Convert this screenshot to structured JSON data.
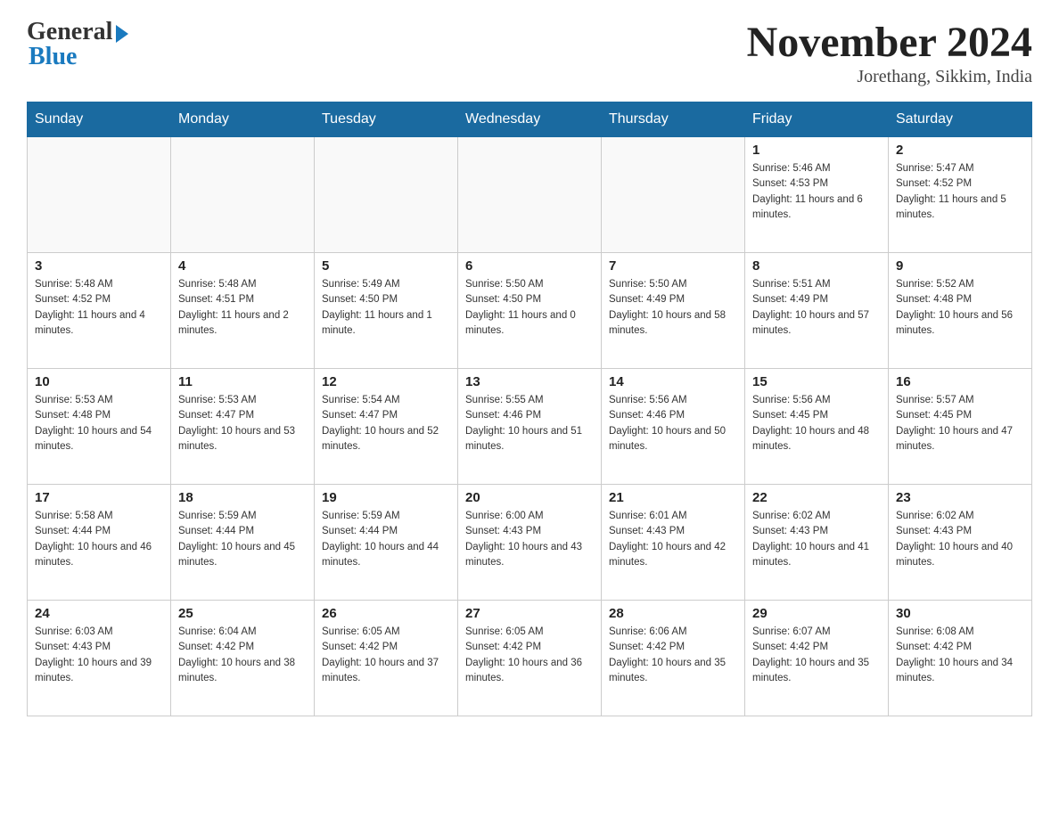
{
  "header": {
    "logo_general": "General",
    "logo_blue": "Blue",
    "month_title": "November 2024",
    "subtitle": "Jorethang, Sikkim, India"
  },
  "weekdays": [
    "Sunday",
    "Monday",
    "Tuesday",
    "Wednesday",
    "Thursday",
    "Friday",
    "Saturday"
  ],
  "weeks": [
    [
      {
        "day": "",
        "info": ""
      },
      {
        "day": "",
        "info": ""
      },
      {
        "day": "",
        "info": ""
      },
      {
        "day": "",
        "info": ""
      },
      {
        "day": "",
        "info": ""
      },
      {
        "day": "1",
        "info": "Sunrise: 5:46 AM\nSunset: 4:53 PM\nDaylight: 11 hours and 6 minutes."
      },
      {
        "day": "2",
        "info": "Sunrise: 5:47 AM\nSunset: 4:52 PM\nDaylight: 11 hours and 5 minutes."
      }
    ],
    [
      {
        "day": "3",
        "info": "Sunrise: 5:48 AM\nSunset: 4:52 PM\nDaylight: 11 hours and 4 minutes."
      },
      {
        "day": "4",
        "info": "Sunrise: 5:48 AM\nSunset: 4:51 PM\nDaylight: 11 hours and 2 minutes."
      },
      {
        "day": "5",
        "info": "Sunrise: 5:49 AM\nSunset: 4:50 PM\nDaylight: 11 hours and 1 minute."
      },
      {
        "day": "6",
        "info": "Sunrise: 5:50 AM\nSunset: 4:50 PM\nDaylight: 11 hours and 0 minutes."
      },
      {
        "day": "7",
        "info": "Sunrise: 5:50 AM\nSunset: 4:49 PM\nDaylight: 10 hours and 58 minutes."
      },
      {
        "day": "8",
        "info": "Sunrise: 5:51 AM\nSunset: 4:49 PM\nDaylight: 10 hours and 57 minutes."
      },
      {
        "day": "9",
        "info": "Sunrise: 5:52 AM\nSunset: 4:48 PM\nDaylight: 10 hours and 56 minutes."
      }
    ],
    [
      {
        "day": "10",
        "info": "Sunrise: 5:53 AM\nSunset: 4:48 PM\nDaylight: 10 hours and 54 minutes."
      },
      {
        "day": "11",
        "info": "Sunrise: 5:53 AM\nSunset: 4:47 PM\nDaylight: 10 hours and 53 minutes."
      },
      {
        "day": "12",
        "info": "Sunrise: 5:54 AM\nSunset: 4:47 PM\nDaylight: 10 hours and 52 minutes."
      },
      {
        "day": "13",
        "info": "Sunrise: 5:55 AM\nSunset: 4:46 PM\nDaylight: 10 hours and 51 minutes."
      },
      {
        "day": "14",
        "info": "Sunrise: 5:56 AM\nSunset: 4:46 PM\nDaylight: 10 hours and 50 minutes."
      },
      {
        "day": "15",
        "info": "Sunrise: 5:56 AM\nSunset: 4:45 PM\nDaylight: 10 hours and 48 minutes."
      },
      {
        "day": "16",
        "info": "Sunrise: 5:57 AM\nSunset: 4:45 PM\nDaylight: 10 hours and 47 minutes."
      }
    ],
    [
      {
        "day": "17",
        "info": "Sunrise: 5:58 AM\nSunset: 4:44 PM\nDaylight: 10 hours and 46 minutes."
      },
      {
        "day": "18",
        "info": "Sunrise: 5:59 AM\nSunset: 4:44 PM\nDaylight: 10 hours and 45 minutes."
      },
      {
        "day": "19",
        "info": "Sunrise: 5:59 AM\nSunset: 4:44 PM\nDaylight: 10 hours and 44 minutes."
      },
      {
        "day": "20",
        "info": "Sunrise: 6:00 AM\nSunset: 4:43 PM\nDaylight: 10 hours and 43 minutes."
      },
      {
        "day": "21",
        "info": "Sunrise: 6:01 AM\nSunset: 4:43 PM\nDaylight: 10 hours and 42 minutes."
      },
      {
        "day": "22",
        "info": "Sunrise: 6:02 AM\nSunset: 4:43 PM\nDaylight: 10 hours and 41 minutes."
      },
      {
        "day": "23",
        "info": "Sunrise: 6:02 AM\nSunset: 4:43 PM\nDaylight: 10 hours and 40 minutes."
      }
    ],
    [
      {
        "day": "24",
        "info": "Sunrise: 6:03 AM\nSunset: 4:43 PM\nDaylight: 10 hours and 39 minutes."
      },
      {
        "day": "25",
        "info": "Sunrise: 6:04 AM\nSunset: 4:42 PM\nDaylight: 10 hours and 38 minutes."
      },
      {
        "day": "26",
        "info": "Sunrise: 6:05 AM\nSunset: 4:42 PM\nDaylight: 10 hours and 37 minutes."
      },
      {
        "day": "27",
        "info": "Sunrise: 6:05 AM\nSunset: 4:42 PM\nDaylight: 10 hours and 36 minutes."
      },
      {
        "day": "28",
        "info": "Sunrise: 6:06 AM\nSunset: 4:42 PM\nDaylight: 10 hours and 35 minutes."
      },
      {
        "day": "29",
        "info": "Sunrise: 6:07 AM\nSunset: 4:42 PM\nDaylight: 10 hours and 35 minutes."
      },
      {
        "day": "30",
        "info": "Sunrise: 6:08 AM\nSunset: 4:42 PM\nDaylight: 10 hours and 34 minutes."
      }
    ]
  ]
}
